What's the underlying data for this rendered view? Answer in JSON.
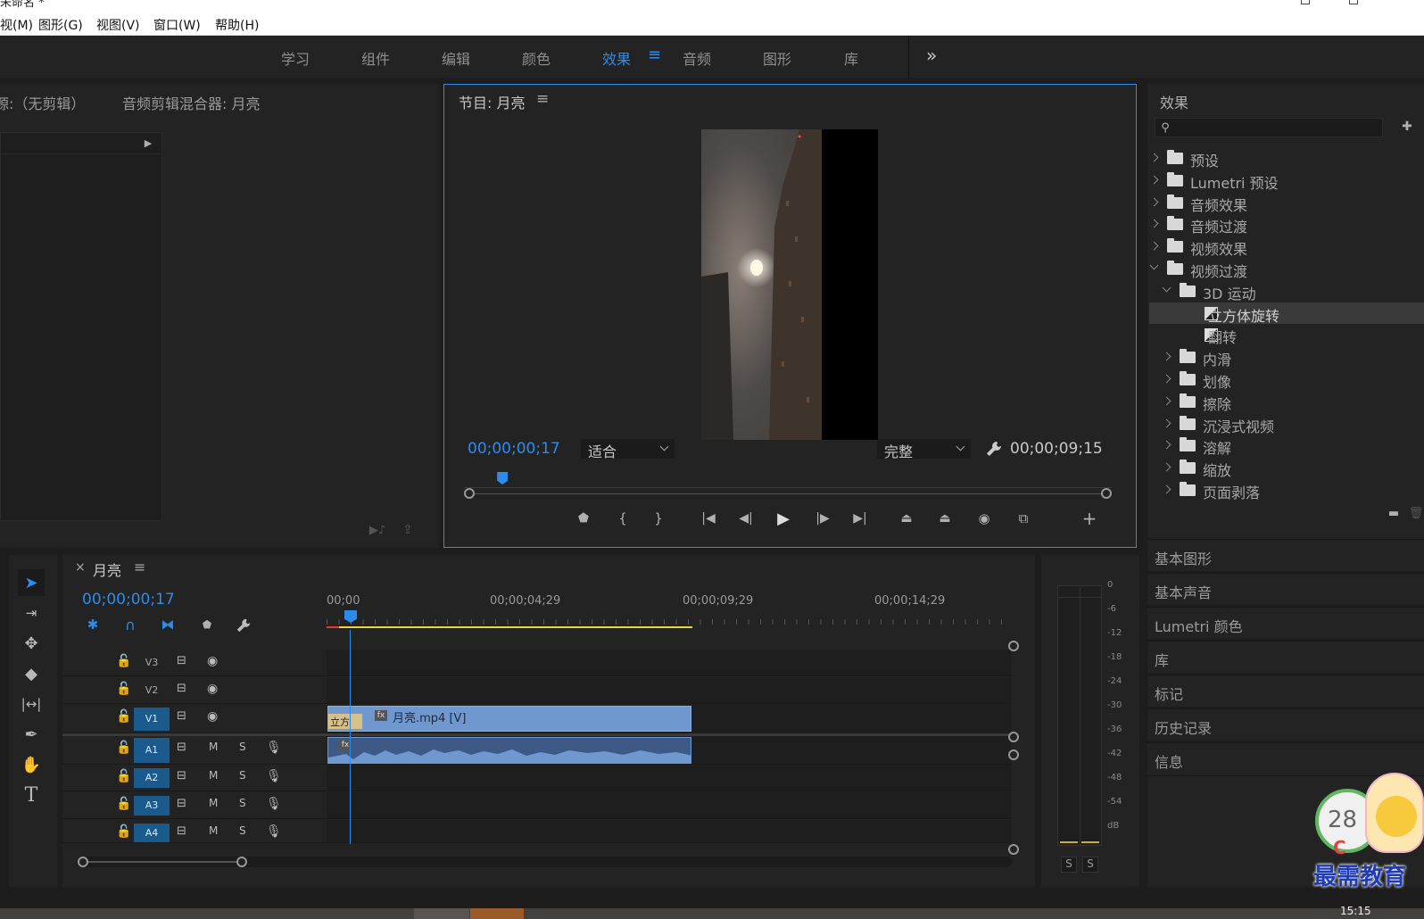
{
  "window": {
    "title": "未命名 *"
  },
  "menu": [
    "视(M)",
    "图形(G)",
    "视图(V)",
    "窗口(W)",
    "帮助(H)"
  ],
  "workspaces": {
    "tabs": [
      "学习",
      "组件",
      "编辑",
      "颜色",
      "效果",
      "音频",
      "图形",
      "库"
    ],
    "active": "效果",
    "menu_icon": "≡",
    "overflow": "»"
  },
  "source_panel": {
    "tab_source": "源:（无剪辑）",
    "tab_mixer": "音频剪辑混合器: 月亮"
  },
  "program": {
    "title": "节目: 月亮",
    "menu_icon": "≡",
    "timecode_current": "00;00;00;17",
    "zoom": "适合",
    "quality": "完整",
    "timecode_duration": "00;00;09;15",
    "playhead_fraction": 0.052
  },
  "effects_panel": {
    "title": "效果",
    "search_placeholder": "",
    "tree": [
      {
        "label": "预设",
        "type": "folder-star",
        "level": 0,
        "open": false
      },
      {
        "label": "Lumetri 预设",
        "type": "folder-star",
        "level": 0,
        "open": false
      },
      {
        "label": "音频效果",
        "type": "folder",
        "level": 0,
        "open": false
      },
      {
        "label": "音频过渡",
        "type": "folder",
        "level": 0,
        "open": false
      },
      {
        "label": "视频效果",
        "type": "folder",
        "level": 0,
        "open": false
      },
      {
        "label": "视频过渡",
        "type": "folder",
        "level": 0,
        "open": true
      },
      {
        "label": "3D 运动",
        "type": "folder",
        "level": 1,
        "open": true
      },
      {
        "label": "立方体旋转",
        "type": "transition",
        "level": 2,
        "selected": true
      },
      {
        "label": "翻转",
        "type": "transition",
        "level": 2
      },
      {
        "label": "内滑",
        "type": "folder",
        "level": 1,
        "open": false
      },
      {
        "label": "划像",
        "type": "folder",
        "level": 1,
        "open": false
      },
      {
        "label": "擦除",
        "type": "folder",
        "level": 1,
        "open": false
      },
      {
        "label": "沉浸式视频",
        "type": "folder",
        "level": 1,
        "open": false
      },
      {
        "label": "溶解",
        "type": "folder",
        "level": 1,
        "open": false
      },
      {
        "label": "缩放",
        "type": "folder",
        "level": 1,
        "open": false
      },
      {
        "label": "页面剥落",
        "type": "folder",
        "level": 1,
        "open": false
      }
    ]
  },
  "side_panels": [
    "基本图形",
    "基本声音",
    "Lumetri 颜色",
    "库",
    "标记",
    "历史记录",
    "信息"
  ],
  "timeline": {
    "sequence_name": "月亮",
    "close": "×",
    "menu_icon": "≡",
    "timecode": "00;00;00;17",
    "ruler": [
      "00;00",
      "00;00;04;29",
      "00;00;09;29",
      "00;00;14;29"
    ],
    "video_tracks": [
      {
        "name": "V3",
        "targeted": false
      },
      {
        "name": "V2",
        "targeted": false
      },
      {
        "name": "V1",
        "targeted": true
      }
    ],
    "audio_tracks": [
      {
        "name": "A1",
        "targeted": true,
        "m": "M",
        "s": "S"
      },
      {
        "name": "A2",
        "targeted": true,
        "m": "M",
        "s": "S"
      },
      {
        "name": "A3",
        "targeted": true,
        "m": "M",
        "s": "S"
      },
      {
        "name": "A4",
        "targeted": true,
        "m": "M",
        "s": "S"
      }
    ],
    "video_clip": {
      "label": "月亮.mp4 [V]",
      "transition_label": "立方"
    },
    "clip_badge": "fx"
  },
  "audio_meter": {
    "scale": [
      "0",
      "-6",
      "-12",
      "-18",
      "-24",
      "-30",
      "-36",
      "-42",
      "-48",
      "-54",
      "dB"
    ],
    "solo": [
      "S",
      "S"
    ]
  },
  "watermark": {
    "badge_number": "28",
    "letter": "C",
    "text": "最需教育"
  },
  "taskbar": {
    "clock": "15:15"
  },
  "colors": {
    "accent": "#2d8ceb",
    "panel": "#232323",
    "clip_video": "#6f98d0",
    "clip_audio": "#6f98d0",
    "work_area": "#e8d840"
  }
}
